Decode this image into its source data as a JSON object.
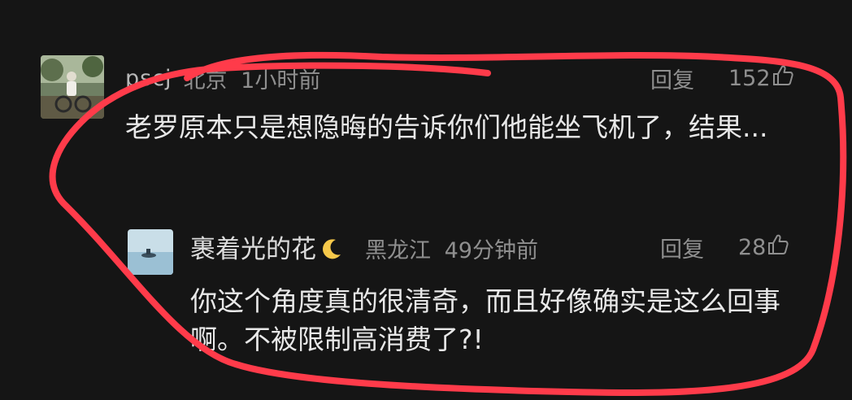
{
  "comments": [
    {
      "username": "pscj",
      "location": "北京",
      "time": "1小时前",
      "reply_label": "回复",
      "like_count": "152",
      "text": "老罗原本只是想隐晦的告诉你们他能坐飞机了，结果...",
      "avatar_icon": "photo-avatar-person-on-bike"
    },
    {
      "username": "裹着光的花",
      "username_emoji": "🌙",
      "location": "黑龙江",
      "time": "49分钟前",
      "reply_label": "回复",
      "like_count": "28",
      "text": "你这个角度真的很清奇，而且好像确实是这么回事啊。不被限制高消费了?!",
      "avatar_icon": "photo-avatar-boat-on-water"
    }
  ],
  "icons": {
    "like": "thumbs-up-icon",
    "moon": "crescent-moon-icon"
  },
  "colors": {
    "background": "#151515",
    "annotation": "#ff3b4a",
    "meta_text": "#8f8f8f",
    "body_text": "#e8e8e8"
  }
}
